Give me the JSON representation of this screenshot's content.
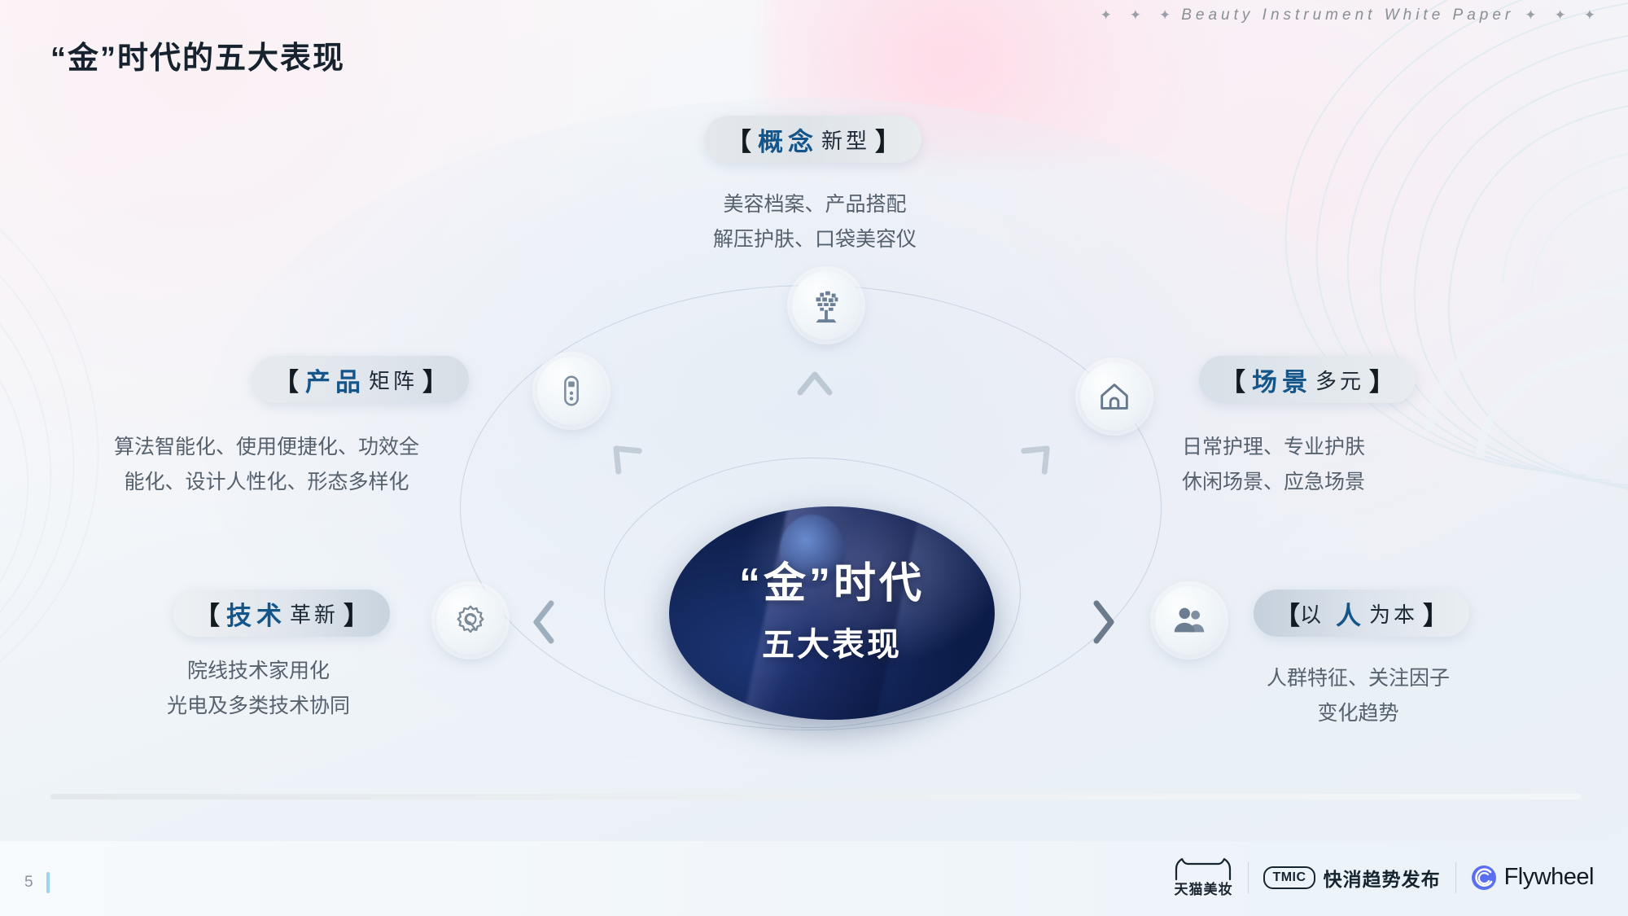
{
  "header": {
    "title": "“金”时代的五大表现",
    "eyebrow": "Beauty Instrument White Paper",
    "diamond": "✦"
  },
  "center": {
    "line1": "“金”时代",
    "line2": "五大表现"
  },
  "nodes": [
    {
      "id": "concept",
      "icon": "tree-icon",
      "label_bracket_open": "【",
      "label_highlight": "概念",
      "label_rest": "新型",
      "label_bracket_close": "】",
      "desc_line1": "美容档案、产品搭配",
      "desc_line2": "解压护肤、口袋美容仪"
    },
    {
      "id": "product",
      "icon": "device-icon",
      "label_bracket_open": "【",
      "label_highlight": "产品",
      "label_rest": "矩阵",
      "label_bracket_close": "】",
      "desc_line1": "算法智能化、使用便捷化、功效全",
      "desc_line2": "能化、设计人性化、形态多样化"
    },
    {
      "id": "scenario",
      "icon": "home-icon",
      "label_bracket_open": "【",
      "label_highlight": "场景",
      "label_rest": "多元",
      "label_bracket_close": "】",
      "desc_line1": "日常护理、专业护肤",
      "desc_line2": "休闲场景、应急场景"
    },
    {
      "id": "technology",
      "icon": "gear-wrench-icon",
      "label_bracket_open": "【",
      "label_highlight": "技术",
      "label_rest": "革新",
      "label_bracket_close": "】",
      "desc_line1": "院线技术家用化",
      "desc_line2": "光电及多类技术协同"
    },
    {
      "id": "people",
      "icon": "people-icon",
      "label_bracket_open": "【",
      "label_highlight_pre": "以",
      "label_highlight": "人",
      "label_rest": "为本",
      "label_bracket_close": "】"
    }
  ],
  "people_desc": {
    "line1": "人群特征、关注因子",
    "line2": "变化趋势"
  },
  "footer": {
    "page_number": "5",
    "logo_tmall": "天猫美妆",
    "logo_tmic_badge": "TMIC",
    "logo_tmic_text": "快消趋势发布",
    "logo_flywheel": "Flywheel"
  },
  "colors": {
    "highlight_blue": "#14558a",
    "dark_text": "#16232f",
    "body_text": "#55616d",
    "page_accent": "#9fd4ec"
  }
}
